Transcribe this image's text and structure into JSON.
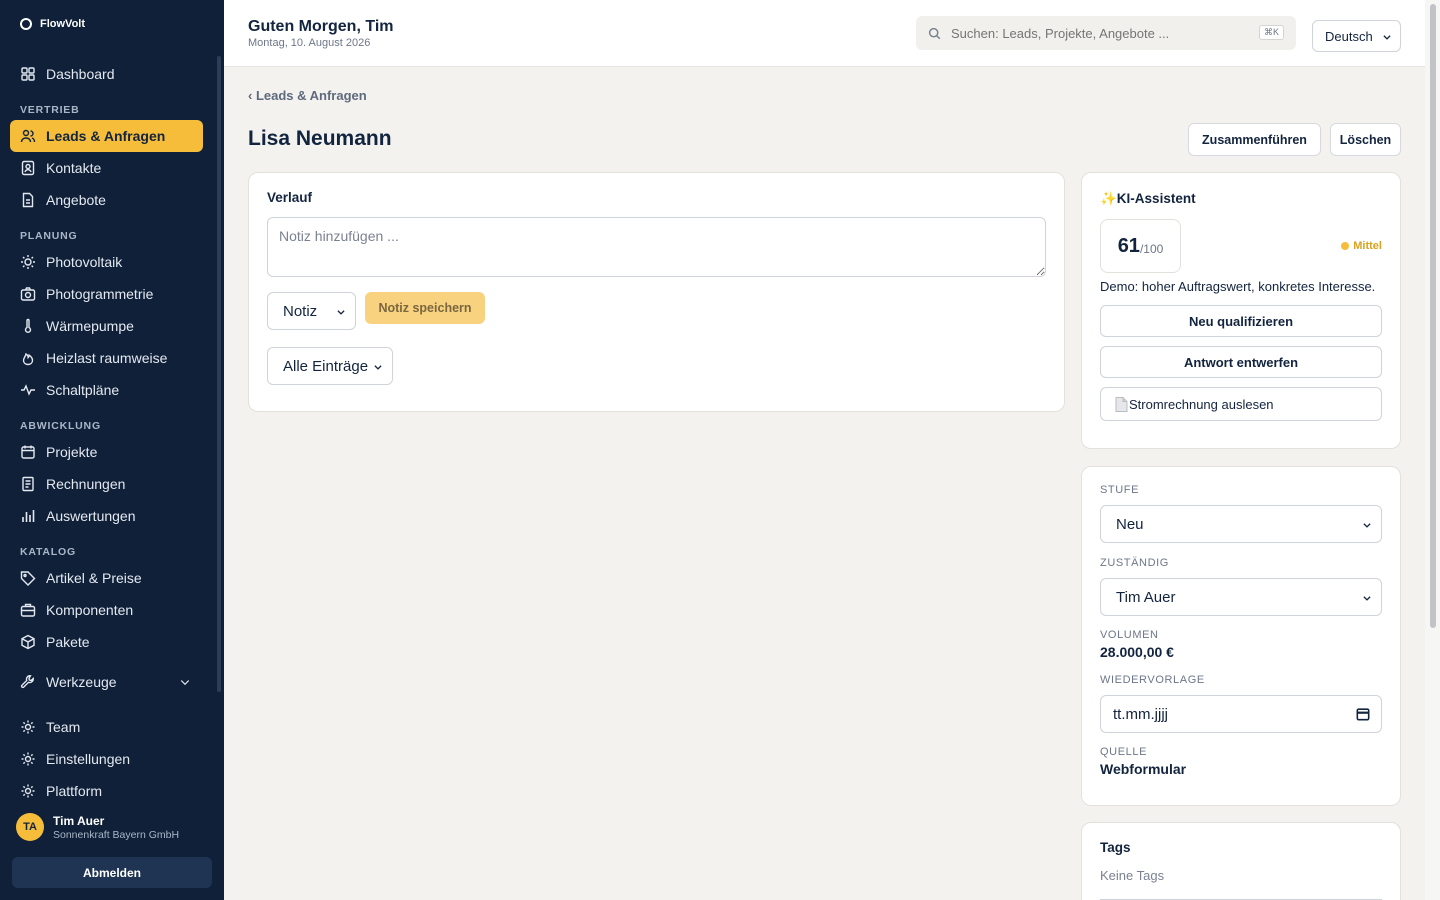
{
  "app": {
    "name": "FlowVolt"
  },
  "sidebar": {
    "dashboard": "Dashboard",
    "sections": {
      "vertrieb": "VERTRIEB",
      "planung": "PLANUNG",
      "abwicklung": "ABWICKLUNG",
      "katalog": "KATALOG"
    },
    "items": {
      "leads": "Leads & Anfragen",
      "kontakte": "Kontakte",
      "angebote": "Angebote",
      "photovoltaik": "Photovoltaik",
      "photogrammetrie": "Photogrammetrie",
      "waermepumpe": "Wärmepumpe",
      "heizlast": "Heizlast raumweise",
      "schaltplaene": "Schaltpläne",
      "projekte": "Projekte",
      "rechnungen": "Rechnungen",
      "auswertungen": "Auswertungen",
      "artikel": "Artikel & Preise",
      "komponenten": "Komponenten",
      "pakete": "Pakete",
      "werkzeuge": "Werkzeuge",
      "team": "Team",
      "einstellungen": "Einstellungen",
      "plattform": "Plattform"
    },
    "user": {
      "initials": "TA",
      "name": "Tim Auer",
      "org": "Sonnenkraft Bayern GmbH"
    },
    "logout_label": "Abmelden"
  },
  "header": {
    "greeting": "Guten Morgen, Tim",
    "date": "Montag, 10. August 2026",
    "search_placeholder": "Suchen: Leads, Projekte, Angebote ...",
    "search_shortcut": "⌘K",
    "language": "Deutsch"
  },
  "page": {
    "breadcrumb": "‹ Leads & Anfragen",
    "title": "Lisa Neumann",
    "merge_label": "Zusammenführen",
    "delete_label": "Löschen"
  },
  "history": {
    "title": "Verlauf",
    "note_placeholder": "Notiz hinzufügen ...",
    "type_select": "Notiz",
    "save_label": "Notiz speichern",
    "filter_select": "Alle Einträge"
  },
  "ai": {
    "title": "✨KI-Assistent",
    "score": "61",
    "score_max": "/100",
    "priority": "Mittel",
    "summary": "Demo: hoher Auftragswert, konkretes Interesse.",
    "requalify_label": "Neu qualifizieren",
    "draft_label": "Antwort entwerfen",
    "bill_label": "Stromrechnung auslesen"
  },
  "details": {
    "stage_label": "STUFE",
    "stage_value": "Neu",
    "owner_label": "ZUSTÄNDIG",
    "owner_value": "Tim Auer",
    "volume_label": "VOLUMEN",
    "volume_value": "28.000,00 €",
    "followup_label": "WIEDERVORLAGE",
    "followup_placeholder": "tt.mm.jjjj",
    "source_label": "QUELLE",
    "source_value": "Webformular"
  },
  "tags": {
    "title": "Tags",
    "empty": "Keine Tags"
  },
  "colors": {
    "accent": "#f6bd3a",
    "sidebar": "#0f2038",
    "background": "#f3f2ee"
  }
}
